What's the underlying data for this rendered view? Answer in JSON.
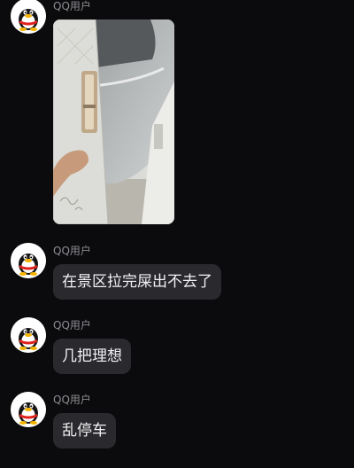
{
  "messages": [
    {
      "sender": "QQ用户",
      "type": "image",
      "text": ""
    },
    {
      "sender": "QQ用户",
      "type": "text",
      "text": "在景区拉完屎出不去了"
    },
    {
      "sender": "QQ用户",
      "type": "text",
      "text": "几把理想"
    },
    {
      "sender": "QQ用户",
      "type": "text",
      "text": "乱停车"
    }
  ],
  "colors": {
    "background": "#0b0b0d",
    "bubble": "#2a2a2e",
    "sender_text": "#8d8d93",
    "message_text": "#f2f2f4"
  },
  "icons": {
    "avatar": "qq-penguin-avatar-icon"
  }
}
